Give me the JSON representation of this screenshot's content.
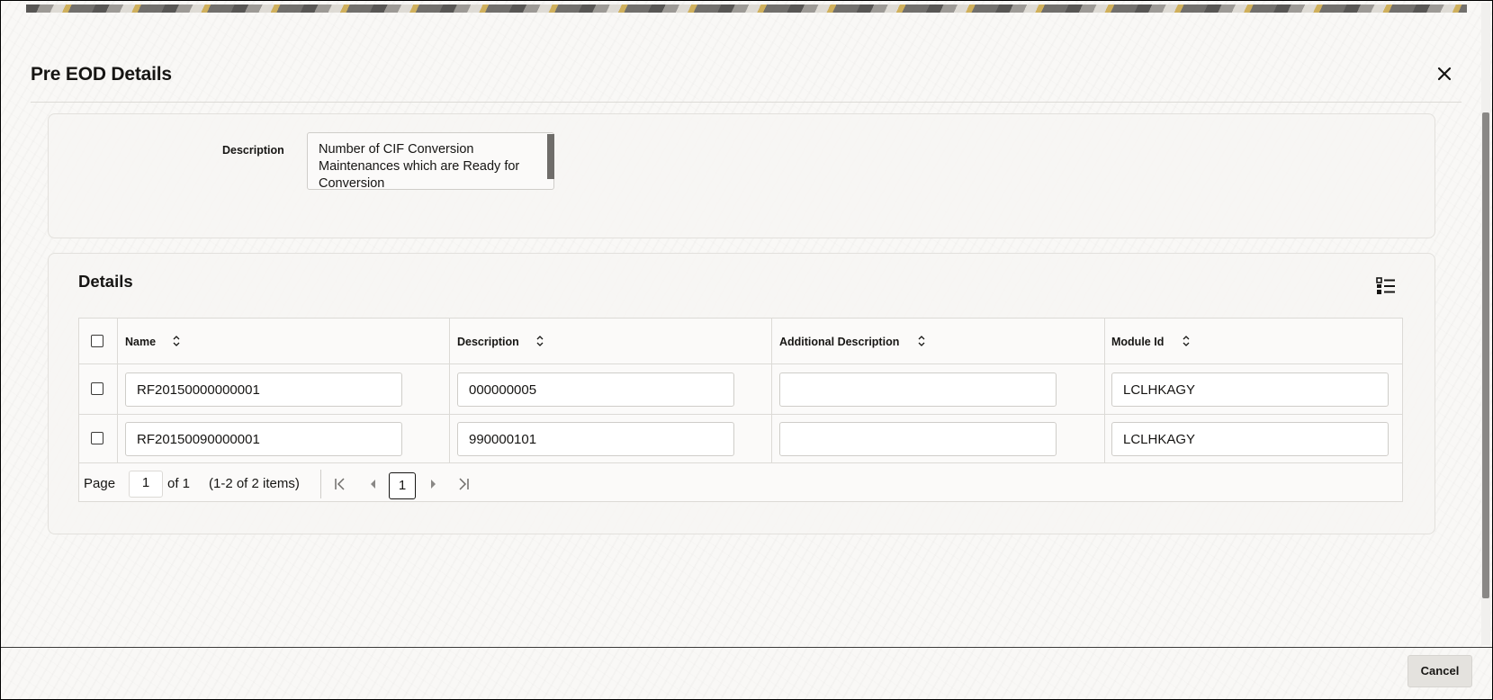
{
  "dialog": {
    "title": "Pre EOD Details",
    "close_icon": "close-icon"
  },
  "header_panel": {
    "description_label": "Description",
    "description_value": "Number of CIF Conversion Maintenances which are Ready for Conversion"
  },
  "details": {
    "title": "Details",
    "columns_icon": "list-columns-icon",
    "columns": [
      "Name",
      "Description",
      "Additional Description",
      "Module Id"
    ],
    "rows": [
      {
        "name": "RF20150000000001",
        "description": "000000005",
        "additional_description": "",
        "module_id": "LCLHKAGY"
      },
      {
        "name": "RF20150090000001",
        "description": "990000101",
        "additional_description": "",
        "module_id": "LCLHKAGY"
      }
    ],
    "pager": {
      "page_label": "Page",
      "page_value": "1",
      "of_label": "of 1",
      "items_summary": "(1-2 of 2 items)",
      "current_page": "1"
    }
  },
  "footer": {
    "cancel_label": "Cancel"
  },
  "colors": {
    "text": "#161513",
    "panel_bg": "#f6f5f3",
    "border": "#dcdad6",
    "button_bg": "#e4e2de"
  }
}
